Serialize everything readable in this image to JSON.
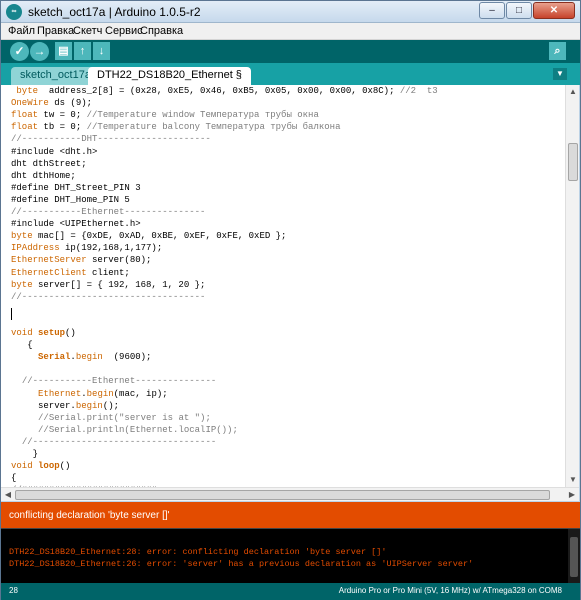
{
  "window": {
    "title": "sketch_oct17a | Arduino 1.0.5-r2",
    "app_icon_text": "∞",
    "controls": {
      "minimize": "–",
      "maximize": "□",
      "close": "✕"
    }
  },
  "menu": {
    "items": [
      "Файл",
      "Правка",
      "Скетч",
      "Сервис",
      "Справка"
    ]
  },
  "toolbar": {
    "verify": "✓",
    "upload": "→",
    "new": "▤",
    "open": "↑",
    "save": "↓",
    "serial_monitor": "⌕"
  },
  "tabs": {
    "items": [
      {
        "label": "sketch_oct17a"
      },
      {
        "label": "DTH22_DS18B20_Ethernet §"
      }
    ],
    "menu_icon": "▼"
  },
  "colors": {
    "keyword": "#cc6600",
    "type": "#cc6600",
    "comment": "#7e7e7e",
    "error": "#e34c00",
    "toolbar": "#006468"
  },
  "editor": {
    "lines": [
      [
        {
          "t": " "
        },
        {
          "t": "byte",
          "c": "type"
        },
        {
          "t": "  address_2[8] = (0x28, 0xE5, 0x46, 0xB5, 0x05, 0x00, 0x00, 0x8C); "
        },
        {
          "t": "//2  t3",
          "c": "comment"
        }
      ],
      [
        {
          "t": "OneWire",
          "c": "type"
        },
        {
          "t": " ds (9);"
        }
      ],
      [
        {
          "t": "float",
          "c": "type"
        },
        {
          "t": " tw = 0; "
        },
        {
          "t": "//Temperature window Температура трубы окна",
          "c": "comment"
        }
      ],
      [
        {
          "t": "float",
          "c": "type"
        },
        {
          "t": " tb = 0; "
        },
        {
          "t": "//Temperature balcony Температура трубы балкона",
          "c": "comment"
        }
      ],
      [
        {
          "t": "//-----------DHT---------------------",
          "c": "comment"
        }
      ],
      [
        {
          "t": "#include <dht.h>"
        }
      ],
      [
        {
          "t": "dht dthStreet;"
        }
      ],
      [
        {
          "t": "dht dthHome;"
        }
      ],
      [
        {
          "t": "#define DHT_Street_PIN 3"
        }
      ],
      [
        {
          "t": "#define DHT_Home_PIN 5"
        }
      ],
      [
        {
          "t": "//-----------Ethernet---------------",
          "c": "comment"
        }
      ],
      [
        {
          "t": "#include <UIPEthernet.h>"
        }
      ],
      [
        {
          "t": "byte",
          "c": "type"
        },
        {
          "t": " mac[] = {0xDE, 0xAD, 0xBE, 0xEF, 0xFE, 0xED };"
        }
      ],
      [
        {
          "t": "IPAddress",
          "c": "type"
        },
        {
          "t": " ip(192,168,1,177);"
        }
      ],
      [
        {
          "t": "EthernetServer",
          "c": "type"
        },
        {
          "t": " server(80);"
        }
      ],
      [
        {
          "t": "EthernetClient",
          "c": "type"
        },
        {
          "t": " client;"
        }
      ],
      [
        {
          "t": "byte",
          "c": "type"
        },
        {
          "t": " server[] = { 192, 168, 1, 20 };"
        }
      ],
      [
        {
          "t": "//----------------------------------",
          "c": "comment"
        }
      ],
      [
        {
          "t": ""
        }
      ],
      [
        {
          "t": ""
        }
      ],
      [
        {
          "t": "void",
          "c": "type"
        },
        {
          "t": " "
        },
        {
          "t": "setup",
          "c": "keyword",
          "b": true
        },
        {
          "t": "()"
        }
      ],
      [
        {
          "t": "   {"
        }
      ],
      [
        {
          "t": "     "
        },
        {
          "t": "Serial",
          "c": "keyword",
          "b": true
        },
        {
          "t": "."
        },
        {
          "t": "begin",
          "c": "keyword"
        },
        {
          "t": "  (9600);"
        }
      ],
      [
        {
          "t": ""
        }
      ],
      [
        {
          "t": "  "
        },
        {
          "t": "//-----------Ethernet---------------",
          "c": "comment"
        }
      ],
      [
        {
          "t": "     "
        },
        {
          "t": "Ethernet",
          "c": "keyword"
        },
        {
          "t": "."
        },
        {
          "t": "begin",
          "c": "keyword"
        },
        {
          "t": "(mac, ip);"
        }
      ],
      [
        {
          "t": "     server."
        },
        {
          "t": "begin",
          "c": "keyword"
        },
        {
          "t": "();"
        }
      ],
      [
        {
          "t": "     "
        },
        {
          "t": "//Serial.print(\"server is at \");",
          "c": "comment"
        }
      ],
      [
        {
          "t": "     "
        },
        {
          "t": "//Serial.println(Ethernet.localIP());",
          "c": "comment"
        }
      ],
      [
        {
          "t": "  "
        },
        {
          "t": "//----------------------------------",
          "c": "comment"
        }
      ],
      [
        {
          "t": "    }"
        }
      ],
      [
        {
          "t": "void",
          "c": "type"
        },
        {
          "t": " "
        },
        {
          "t": "loop",
          "c": "keyword",
          "b": true
        },
        {
          "t": "()"
        }
      ],
      [
        {
          "t": "{"
        }
      ],
      [
        {
          "t": "//#########################",
          "c": "comment"
        }
      ]
    ]
  },
  "scrollbars": {
    "up": "▲",
    "down": "▼",
    "left": "◀",
    "right": "▶",
    "grip": "|||"
  },
  "status": {
    "message": "conflicting declaration 'byte server []'"
  },
  "console": {
    "lines": [
      "DTH22_DS18B20_Ethernet:28: error: conflicting declaration 'byte server []'",
      "DTH22_DS18B20_Ethernet:26: error: 'server' has a previous declaration as 'UIPServer server'"
    ]
  },
  "footer": {
    "line_number": "28",
    "board": "Arduino Pro or Pro Mini (5V, 16 MHz) w/ ATmega328 on COM8"
  }
}
